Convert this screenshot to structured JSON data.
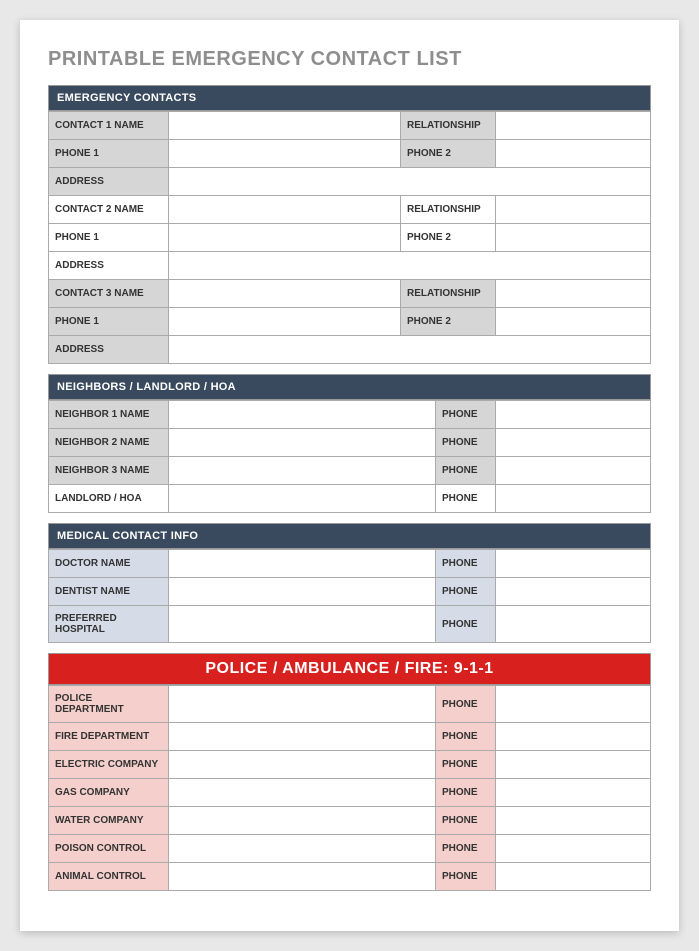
{
  "title": "PRINTABLE EMERGENCY CONTACT LIST",
  "sections": {
    "emergency": {
      "header": "EMERGENCY CONTACTS",
      "contacts": [
        {
          "name_label": "CONTACT 1 NAME",
          "rel_label": "RELATIONSHIP",
          "phone1_label": "PHONE 1",
          "phone2_label": "PHONE 2",
          "addr_label": "ADDRESS",
          "name": "",
          "rel": "",
          "phone1": "",
          "phone2": "",
          "addr": ""
        },
        {
          "name_label": "CONTACT 2 NAME",
          "rel_label": "RELATIONSHIP",
          "phone1_label": "PHONE 1",
          "phone2_label": "PHONE 2",
          "addr_label": "ADDRESS",
          "name": "",
          "rel": "",
          "phone1": "",
          "phone2": "",
          "addr": ""
        },
        {
          "name_label": "CONTACT 3 NAME",
          "rel_label": "RELATIONSHIP",
          "phone1_label": "PHONE 1",
          "phone2_label": "PHONE 2",
          "addr_label": "ADDRESS",
          "name": "",
          "rel": "",
          "phone1": "",
          "phone2": "",
          "addr": ""
        }
      ]
    },
    "neighbors": {
      "header": "NEIGHBORS / LANDLORD / HOA",
      "rows": [
        {
          "label": "NEIGHBOR 1 NAME",
          "phone_label": "PHONE",
          "name": "",
          "phone": ""
        },
        {
          "label": "NEIGHBOR 2 NAME",
          "phone_label": "PHONE",
          "name": "",
          "phone": ""
        },
        {
          "label": "NEIGHBOR 3 NAME",
          "phone_label": "PHONE",
          "name": "",
          "phone": ""
        },
        {
          "label": "LANDLORD / HOA",
          "phone_label": "PHONE",
          "name": "",
          "phone": ""
        }
      ]
    },
    "medical": {
      "header": "MEDICAL CONTACT INFO",
      "rows": [
        {
          "label": "DOCTOR NAME",
          "phone_label": "PHONE",
          "name": "",
          "phone": ""
        },
        {
          "label": "DENTIST NAME",
          "phone_label": "PHONE",
          "name": "",
          "phone": ""
        },
        {
          "label": "PREFERRED HOSPITAL",
          "phone_label": "PHONE",
          "name": "",
          "phone": ""
        }
      ]
    },
    "emergency911": {
      "header": "POLICE / AMBULANCE / FIRE:  9-1-1",
      "rows": [
        {
          "label": "POLICE DEPARTMENT",
          "phone_label": "PHONE",
          "name": "",
          "phone": ""
        },
        {
          "label": "FIRE DEPARTMENT",
          "phone_label": "PHONE",
          "name": "",
          "phone": ""
        },
        {
          "label": "ELECTRIC COMPANY",
          "phone_label": "PHONE",
          "name": "",
          "phone": ""
        },
        {
          "label": "GAS COMPANY",
          "phone_label": "PHONE",
          "name": "",
          "phone": ""
        },
        {
          "label": "WATER COMPANY",
          "phone_label": "PHONE",
          "name": "",
          "phone": ""
        },
        {
          "label": "POISON CONTROL",
          "phone_label": "PHONE",
          "name": "",
          "phone": ""
        },
        {
          "label": "ANIMAL CONTROL",
          "phone_label": "PHONE",
          "name": "",
          "phone": ""
        }
      ]
    }
  }
}
